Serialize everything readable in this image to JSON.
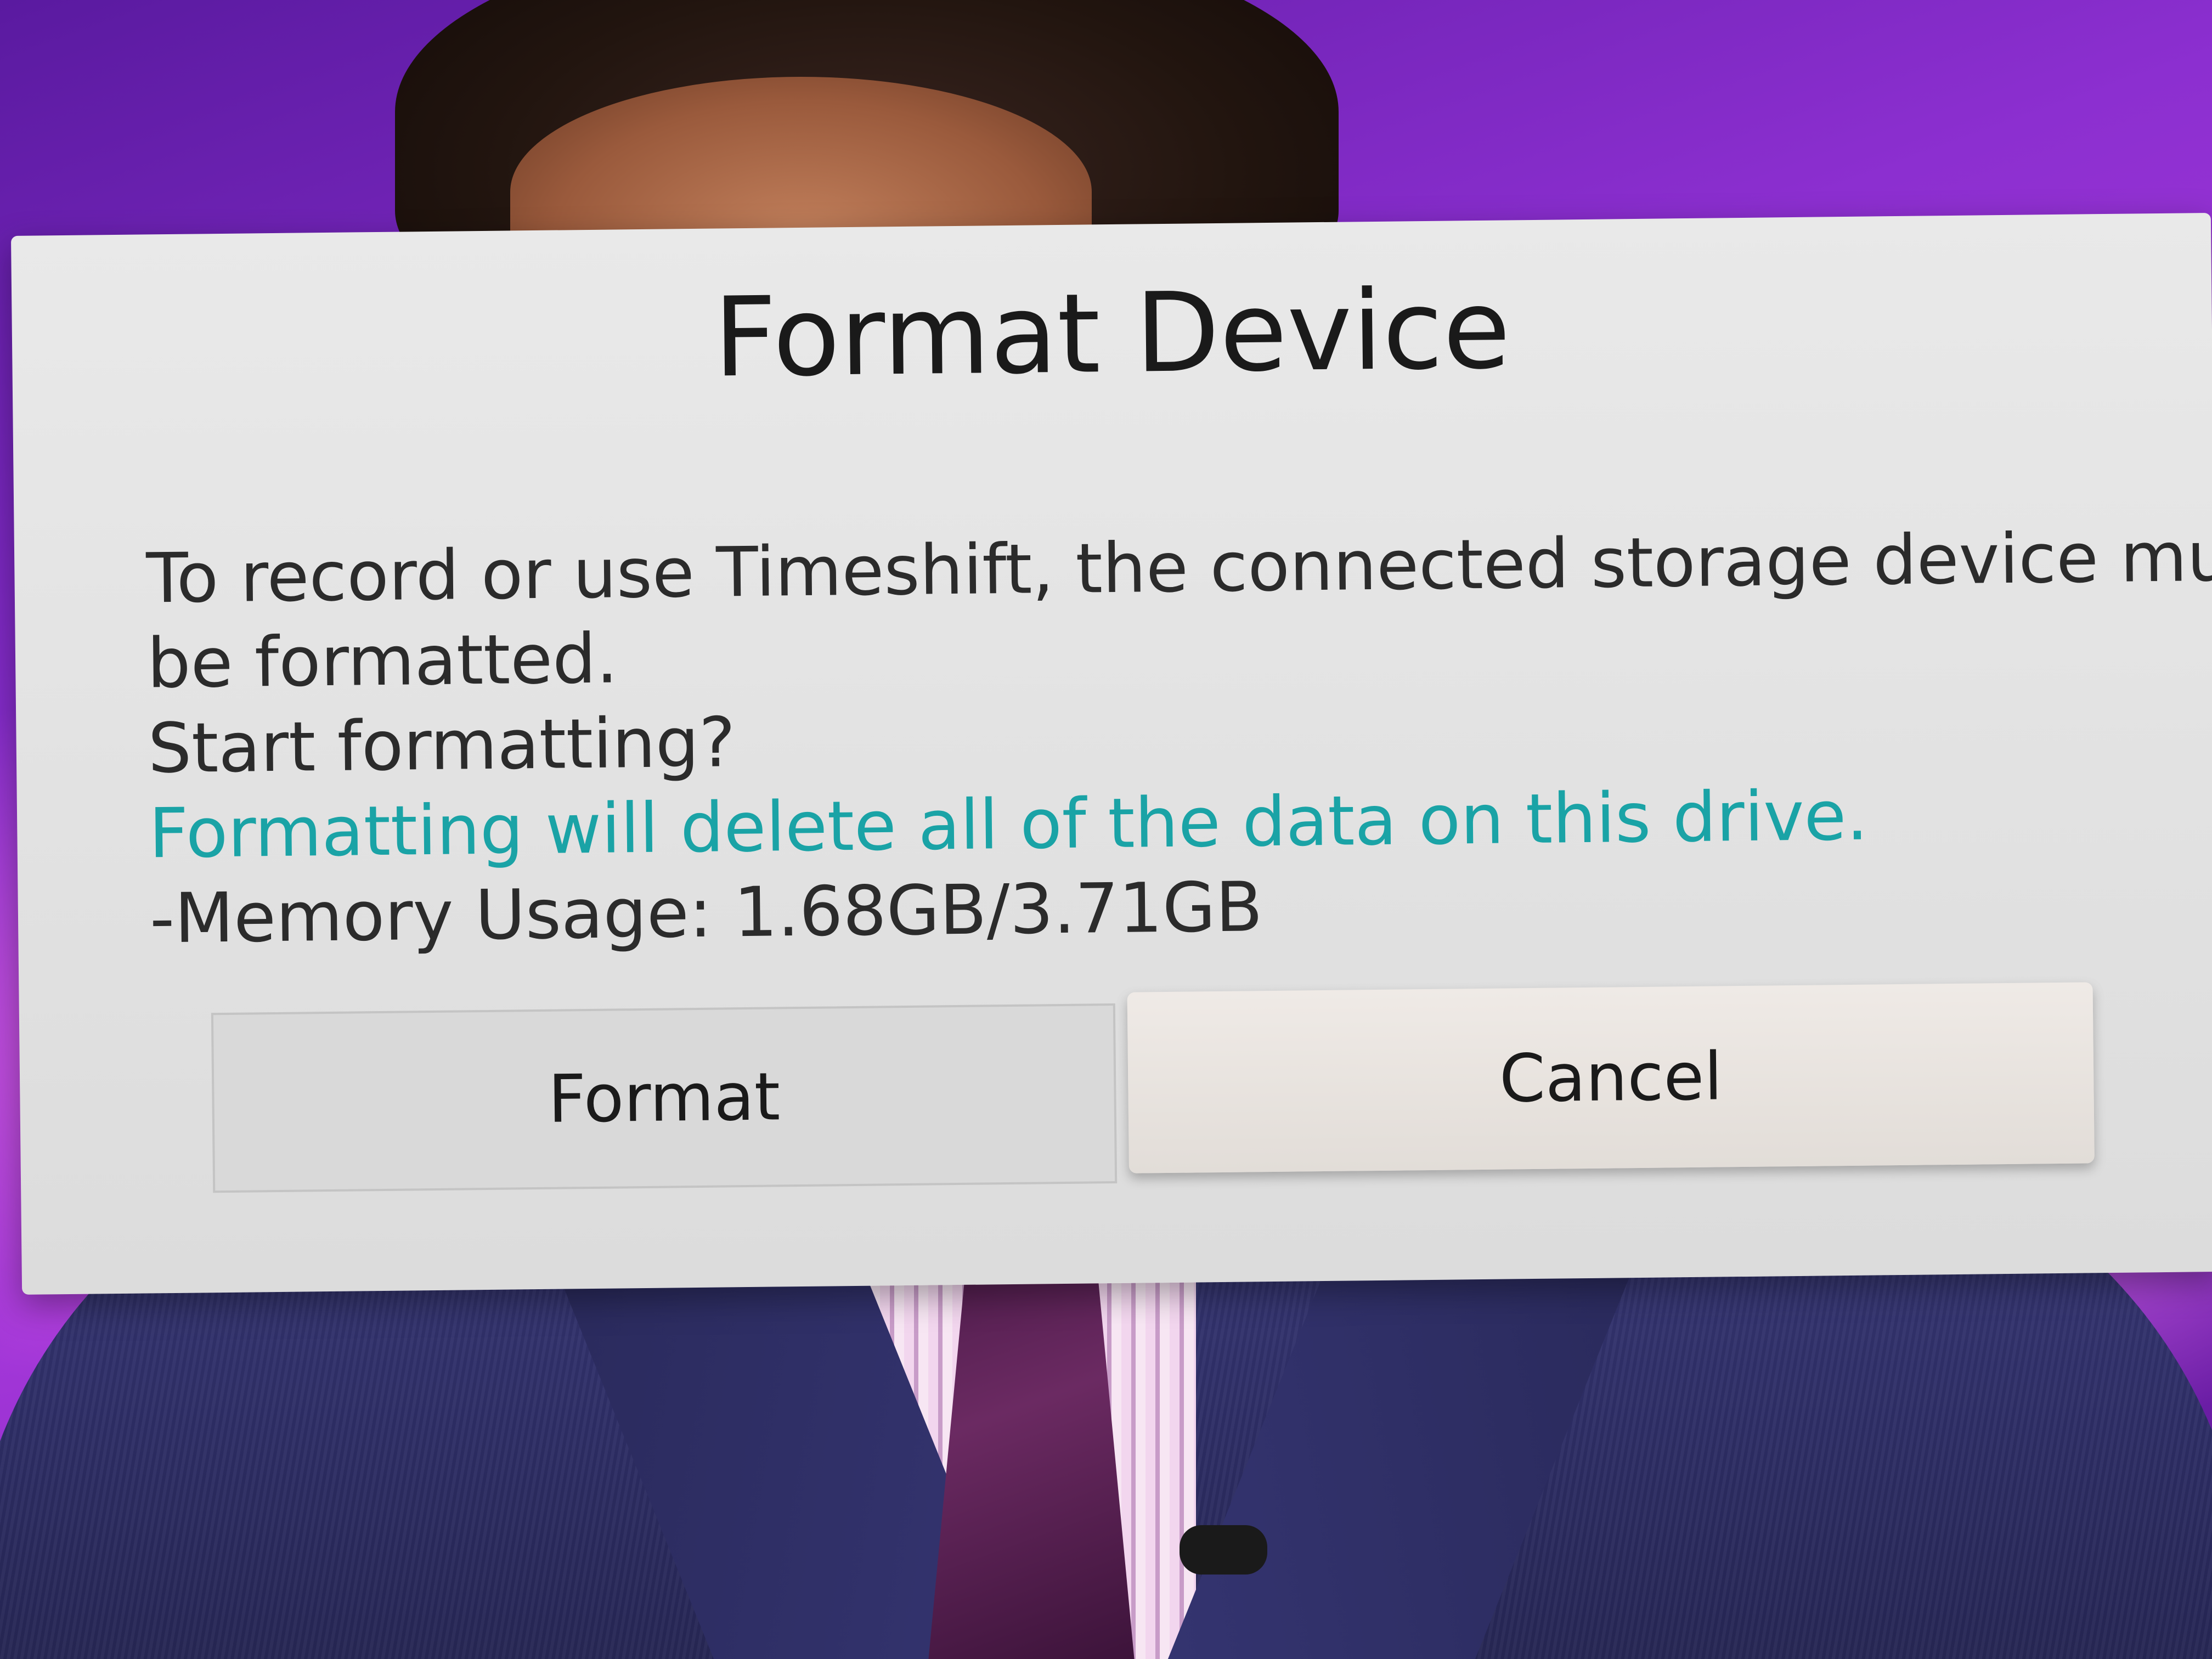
{
  "dialog": {
    "title": "Format Device",
    "body_line_1": "To record or use Timeshift, the connected storage device must",
    "body_line_2": "be formatted.",
    "body_line_3": "Start formatting?",
    "warning": "Formatting will delete all of the data on this drive.",
    "memory_usage": "-Memory Usage: 1.68GB/3.71GB",
    "buttons": {
      "format_label": "Format",
      "cancel_label": "Cancel",
      "focused": "Cancel"
    }
  },
  "colors": {
    "warning_text": "#1aa3a6",
    "dialog_background": "#e2e2e2",
    "background": "#8c2fd0"
  }
}
